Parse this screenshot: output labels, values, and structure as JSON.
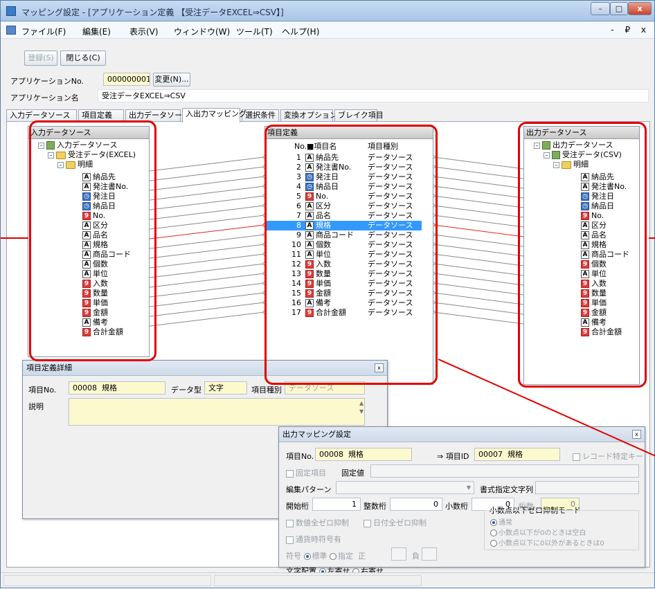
{
  "window": {
    "title": "マッピング設定 - [アプリケーション定義 【受注データEXCEL⇒CSV】]",
    "controls": [
      "–",
      "□",
      "x"
    ]
  },
  "menu": {
    "items": [
      "ファイル(F)",
      "編集(E)",
      "表示(V)",
      "ウィンドウ(W)",
      "ツール(T)",
      "ヘルプ(H)"
    ],
    "controls": "- ₽ x"
  },
  "toolbar": {
    "register": "登録(S)",
    "close": "閉じる(C)"
  },
  "app": {
    "no_label": "アプリケーションNo.",
    "no_value": "000000001",
    "change": "変更(N)...",
    "name_label": "アプリケーション名",
    "name_value": "受注データEXCEL⇒CSV"
  },
  "tabs": [
    "入力データソース",
    "項目定義",
    "出力データソース",
    "入出力マッピング",
    "選択条件",
    "変換オプション",
    "ブレイク項目"
  ],
  "input_panel": {
    "header": "入力データソース",
    "root": "入力データソース",
    "source": "受注データ(EXCEL)",
    "group": "明細",
    "fields": [
      {
        "icon": "A",
        "name": "納品先"
      },
      {
        "icon": "A",
        "name": "発注書No."
      },
      {
        "icon": "C",
        "name": "発注日"
      },
      {
        "icon": "C",
        "name": "納品日"
      },
      {
        "icon": "N",
        "name": "No."
      },
      {
        "icon": "A",
        "name": "区分"
      },
      {
        "icon": "A",
        "name": "品名"
      },
      {
        "icon": "A",
        "name": "規格"
      },
      {
        "icon": "A",
        "name": "商品コード"
      },
      {
        "icon": "A",
        "name": "個数"
      },
      {
        "icon": "A",
        "name": "単位"
      },
      {
        "icon": "N",
        "name": "入数"
      },
      {
        "icon": "N",
        "name": "数量"
      },
      {
        "icon": "N",
        "name": "単価"
      },
      {
        "icon": "N",
        "name": "金額"
      },
      {
        "icon": "A",
        "name": "備考"
      },
      {
        "icon": "N",
        "name": "合計金額"
      }
    ]
  },
  "item_panel": {
    "header": "項目定義",
    "col_no": "No.",
    "col_name": "■項目名",
    "col_type": "項目種別",
    "rows": [
      {
        "no": "1",
        "icon": "A",
        "name": "納品先",
        "type": "データソース"
      },
      {
        "no": "2",
        "icon": "A",
        "name": "発注書No.",
        "type": "データソース"
      },
      {
        "no": "3",
        "icon": "C",
        "name": "発注日",
        "type": "データソース"
      },
      {
        "no": "4",
        "icon": "C",
        "name": "納品日",
        "type": "データソース"
      },
      {
        "no": "5",
        "icon": "N",
        "name": "No.",
        "type": "データソース"
      },
      {
        "no": "6",
        "icon": "A",
        "name": "区分",
        "type": "データソース"
      },
      {
        "no": "7",
        "icon": "A",
        "name": "品名",
        "type": "データソース"
      },
      {
        "no": "8",
        "icon": "A",
        "name": "規格",
        "type": "データソース"
      },
      {
        "no": "9",
        "icon": "A",
        "name": "商品コード",
        "type": "データソース"
      },
      {
        "no": "10",
        "icon": "A",
        "name": "個数",
        "type": "データソース"
      },
      {
        "no": "11",
        "icon": "A",
        "name": "単位",
        "type": "データソース"
      },
      {
        "no": "12",
        "icon": "N",
        "name": "入数",
        "type": "データソース"
      },
      {
        "no": "13",
        "icon": "N",
        "name": "数量",
        "type": "データソース"
      },
      {
        "no": "14",
        "icon": "N",
        "name": "単価",
        "type": "データソース"
      },
      {
        "no": "15",
        "icon": "N",
        "name": "金額",
        "type": "データソース"
      },
      {
        "no": "16",
        "icon": "A",
        "name": "備考",
        "type": "データソース"
      },
      {
        "no": "17",
        "icon": "N",
        "name": "合計金額",
        "type": "データソース"
      }
    ],
    "selected_index": 7
  },
  "output_panel": {
    "header": "出力データソース",
    "root": "出力データソース",
    "source": "受注データ(CSV)",
    "group": "明細",
    "fields": [
      {
        "icon": "A",
        "name": "納品先"
      },
      {
        "icon": "A",
        "name": "発注書No."
      },
      {
        "icon": "C",
        "name": "発注日"
      },
      {
        "icon": "C",
        "name": "納品日"
      },
      {
        "icon": "N",
        "name": "No."
      },
      {
        "icon": "A",
        "name": "区分"
      },
      {
        "icon": "A",
        "name": "品名"
      },
      {
        "icon": "A",
        "name": "規格"
      },
      {
        "icon": "A",
        "name": "商品コード"
      },
      {
        "icon": "N",
        "name": "個数"
      },
      {
        "icon": "A",
        "name": "単位"
      },
      {
        "icon": "N",
        "name": "入数"
      },
      {
        "icon": "N",
        "name": "数量"
      },
      {
        "icon": "N",
        "name": "単価"
      },
      {
        "icon": "N",
        "name": "金額"
      },
      {
        "icon": "A",
        "name": "備考"
      },
      {
        "icon": "N",
        "name": "合計金額"
      }
    ]
  },
  "detail": {
    "title": "項目定義詳細",
    "item_no_label": "項目No.",
    "item_no_value": "00008",
    "item_name": "規格",
    "datatype_label": "データ型",
    "datatype_value": "文字",
    "itemtype_label": "項目種別",
    "itemtype_value": "データソース",
    "desc_label": "説明",
    "close": "x"
  },
  "out_mapping": {
    "title": "出力マッピング設定",
    "close": "x",
    "item_no_label": "項目No.",
    "item_no_value": "00008",
    "item_name": "規格",
    "arrow_label": "⇒ 項目ID",
    "item_id_value": "00007",
    "item_id_name": "規格",
    "record_key": "レコード特定キー",
    "fixed_item": "固定項目",
    "fixed_value_label": "固定値",
    "edit_pattern_label": "編集パターン",
    "format_label": "書式指定文字列",
    "start_label": "開始桁",
    "start_value": "1",
    "int_label": "整数桁",
    "int_value": "0",
    "dec_label": "小数桁",
    "dec_value": "0",
    "digits_label": "桁数",
    "digits_value": "0",
    "zero_suppress": "数値全ゼロ抑制",
    "date_zero": "日付全ゼロ抑制",
    "currency": "通貨時符号有",
    "sign_label": "符号",
    "sign_standard": "標準",
    "sign_custom": "指定",
    "positive": "正",
    "negative": "負",
    "align_label": "文字配置",
    "align_left": "左寄せ",
    "align_right": "右寄せ",
    "decimal_mode_title": "小数点以下ゼロ抑制モード",
    "decimal_modes": [
      "通常",
      "小数点以下が0のときは空白",
      "小数点以下に0以外があるときは0"
    ]
  }
}
